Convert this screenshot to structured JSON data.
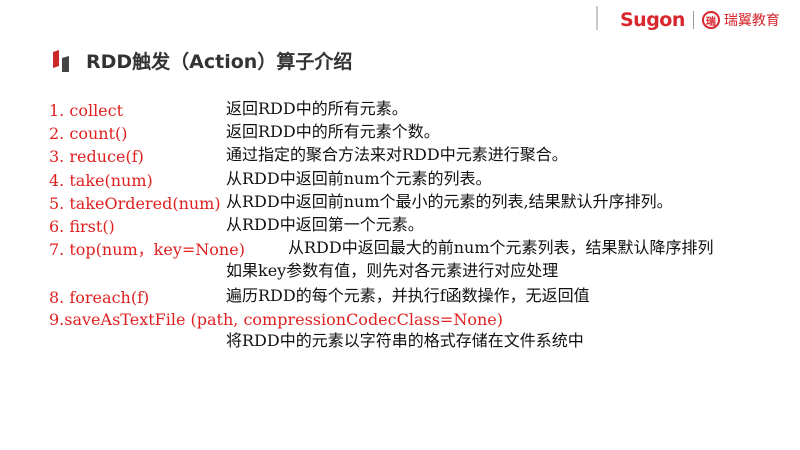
{
  "header": {
    "brand": "Sugon",
    "partner_mark": "瑞",
    "partner": "瑞翼教育"
  },
  "title": "RDD触发（Action）算子介绍",
  "items": [
    {
      "fn": "1. collect",
      "desc": "返回RDD中的所有元素。"
    },
    {
      "fn": "2. count()",
      "desc": "返回RDD中的所有元素个数。"
    },
    {
      "fn": "3. reduce(f)",
      "desc": "通过指定的聚合方法来对RDD中元素进行聚合。"
    },
    {
      "fn": "4. take(num)",
      "desc": "从RDD中返回前num个元素的列表。"
    },
    {
      "fn": "5. takeOrdered(num)",
      "desc": "从RDD中返回前num个最小的元素的列表,结果默认升序排列。"
    },
    {
      "fn": "6. first()",
      "desc": "从RDD中返回第一个元素。"
    },
    {
      "fn": "7. top(num，key=None)",
      "desc": "从RDD中返回最大的前num个元素列表，结果默认降序排列",
      "desc2": "如果key参数有值，则先对各元素进行对应处理"
    },
    {
      "fn": "8. foreach(f)",
      "desc": "遍历RDD的每个元素，并执行f函数操作，无返回值"
    },
    {
      "fn": "9.saveAsTextFile (path, compressionCodecClass=None)",
      "desc": "将RDD中的元素以字符串的格式存储在文件系统中"
    }
  ]
}
